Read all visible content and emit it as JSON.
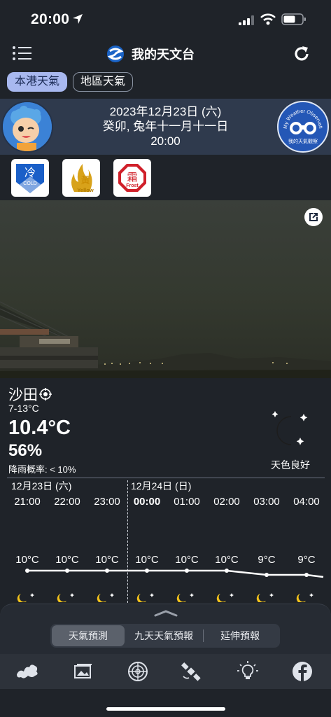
{
  "status_bar": {
    "time": "20:00"
  },
  "header": {
    "title": "我的天文台"
  },
  "region_tabs": [
    {
      "label": "本港天氣",
      "active": true
    },
    {
      "label": "地區天氣",
      "active": false
    }
  ],
  "date_info": {
    "gregorian": "2023年12月23日 (六)",
    "lunar": "癸卯, 兔年十一月十一日",
    "time": "20:00",
    "observation_badge": "My Weather Observation",
    "observation_badge_sub": "我的天氣觀察"
  },
  "warnings": [
    {
      "icon": "cold-warning-icon",
      "char": "冷",
      "label": "COLD",
      "color": "#1a5fc8"
    },
    {
      "icon": "yellow-fire-danger-icon",
      "char": "黃",
      "label": "Yellow",
      "color": "#d8a21a"
    },
    {
      "icon": "frost-warning-icon",
      "char": "霜",
      "label": "Frost",
      "color": "#d0202a"
    }
  ],
  "current": {
    "station": "沙田",
    "range": "7-13°C",
    "temperature": "10.4°C",
    "humidity": "56%",
    "rain": "降雨概率: < 10%",
    "sky": "天色良好"
  },
  "hourly": {
    "day1": "12月23日 (六)",
    "day2": "12月24日 (日)",
    "hours": [
      {
        "time": "21:00",
        "temp": "10°C",
        "value": 10,
        "bold": false
      },
      {
        "time": "22:00",
        "temp": "10°C",
        "value": 10,
        "bold": false
      },
      {
        "time": "23:00",
        "temp": "10°C",
        "value": 10,
        "bold": false
      },
      {
        "time": "00:00",
        "temp": "10°C",
        "value": 10,
        "bold": true
      },
      {
        "time": "01:00",
        "temp": "10°C",
        "value": 10,
        "bold": false
      },
      {
        "time": "02:00",
        "temp": "10°C",
        "value": 10,
        "bold": false
      },
      {
        "time": "03:00",
        "temp": "9°C",
        "value": 9,
        "bold": false
      },
      {
        "time": "04:00",
        "temp": "9°C",
        "value": 9,
        "bold": false
      }
    ]
  },
  "forecast_tabs": [
    {
      "label": "天氣預測",
      "active": true
    },
    {
      "label": "九天天氣預報",
      "active": false
    },
    {
      "label": "延伸預報",
      "active": false
    }
  ],
  "bottom_nav": [
    {
      "icon": "weather-map-icon"
    },
    {
      "icon": "images-icon"
    },
    {
      "icon": "radar-icon"
    },
    {
      "icon": "satellite-icon"
    },
    {
      "icon": "tips-lightbulb-icon"
    },
    {
      "icon": "facebook-icon"
    }
  ]
}
